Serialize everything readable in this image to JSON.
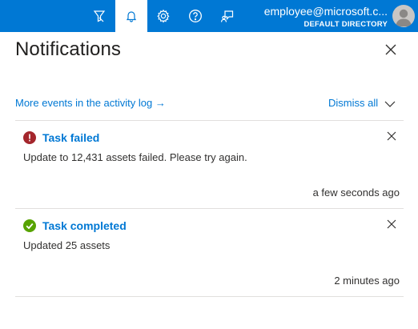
{
  "topbar": {
    "icons": [
      "filter-icon",
      "bell-icon",
      "gear-icon",
      "help-icon",
      "feedback-icon"
    ],
    "account_email": "employee@microsoft.c...",
    "account_directory": "DEFAULT DIRECTORY",
    "accent": "#0078d4"
  },
  "panel": {
    "title": "Notifications",
    "activity_link": "More events in the activity log →",
    "dismiss_label": "Dismiss all"
  },
  "notifications": [
    {
      "status": "error",
      "status_color": "#a4262c",
      "title": "Task failed",
      "message": "Update to 12,431 assets failed. Please try again.",
      "time": "a few seconds ago"
    },
    {
      "status": "success",
      "status_color": "#57a300",
      "title": "Task completed",
      "message": "Updated 25 assets",
      "time": "2 minutes ago"
    }
  ]
}
